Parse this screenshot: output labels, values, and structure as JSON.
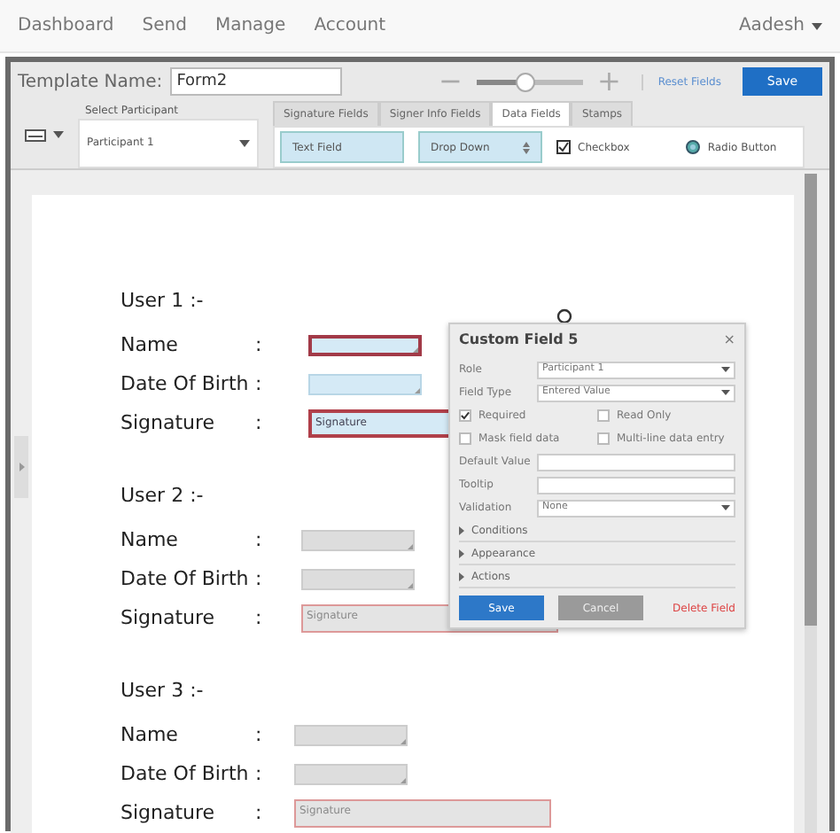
{
  "nav": {
    "links": [
      "Dashboard",
      "Send",
      "Manage",
      "Account"
    ],
    "user": "Aadesh"
  },
  "toolbar": {
    "template_label": "Template Name:",
    "template_name": "Form2",
    "zoom": {
      "level": 0.45,
      "minus": "−",
      "plus": "+"
    },
    "reset": "Reset Fields",
    "save": "Save"
  },
  "participant": {
    "label": "Select Participant",
    "value": "Participant 1"
  },
  "tabs": [
    {
      "label": "Signature Fields",
      "selected": false
    },
    {
      "label": "Signer Info Fields",
      "selected": false
    },
    {
      "label": "Data Fields",
      "selected": true
    },
    {
      "label": "Stamps",
      "selected": false
    }
  ],
  "palette": [
    {
      "kind": "text",
      "label": "Text Field"
    },
    {
      "kind": "select",
      "label": "Drop Down"
    },
    {
      "kind": "checkbox",
      "label": "Checkbox"
    },
    {
      "kind": "radio",
      "label": "Radio Button"
    }
  ],
  "users": [
    {
      "heading": "User 1 :-",
      "fields": [
        {
          "label": "Name",
          "colon": ":",
          "kind": "text",
          "active": true,
          "selected": true
        },
        {
          "label": "Date Of Birth",
          "colon": ":",
          "kind": "text",
          "active": true,
          "selected": false
        },
        {
          "label": "Signature",
          "colon": ":",
          "kind": "signature",
          "text": "Signature",
          "active": true
        }
      ]
    },
    {
      "heading": "User 2 :-",
      "fields": [
        {
          "label": "Name",
          "colon": ":",
          "kind": "text",
          "active": false,
          "selected": false
        },
        {
          "label": "Date Of Birth",
          "colon": ":",
          "kind": "text",
          "active": false,
          "selected": false
        },
        {
          "label": "Signature",
          "colon": ":",
          "kind": "signature",
          "text": "Signature",
          "active": false
        }
      ]
    },
    {
      "heading": "User 3 :-",
      "fields": [
        {
          "label": "Name",
          "colon": ":",
          "kind": "text",
          "active": false,
          "selected": false
        },
        {
          "label": "Date Of Birth",
          "colon": ":",
          "kind": "text",
          "active": false,
          "selected": false
        },
        {
          "label": "Signature",
          "colon": ":",
          "kind": "signature",
          "text": "Signature",
          "active": false
        }
      ]
    }
  ],
  "popup": {
    "title": "Custom Field 5",
    "close": "×",
    "rows": [
      {
        "kind": "select",
        "label": "Role",
        "value": "Participant 1"
      },
      {
        "kind": "select",
        "label": "Field Type",
        "value": "Entered Value"
      }
    ],
    "checks": [
      {
        "label": "Required",
        "checked": true
      },
      {
        "label": "Read Only",
        "checked": false
      },
      {
        "label": "Mask field data",
        "checked": false
      },
      {
        "label": "Multi-line data entry",
        "checked": false
      }
    ],
    "inputs": [
      {
        "kind": "input",
        "label": "Default Value"
      },
      {
        "kind": "input",
        "label": "Tooltip"
      },
      {
        "kind": "select",
        "label": "Validation",
        "value": "None"
      }
    ],
    "sections": [
      "Conditions",
      "Appearance",
      "Actions"
    ],
    "save": "Save",
    "cancel": "Cancel",
    "delete": "Delete Field"
  }
}
